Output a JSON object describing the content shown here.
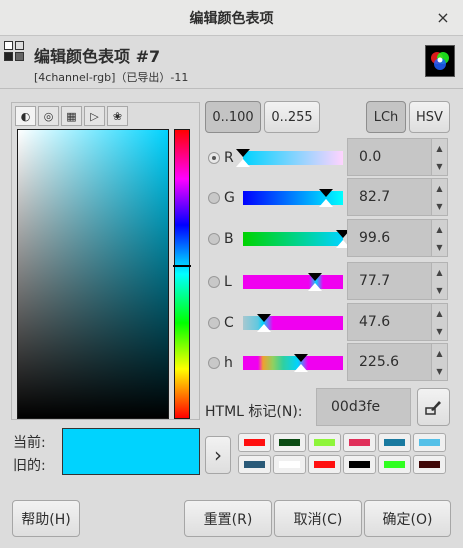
{
  "window": {
    "title": "编辑颜色表项",
    "close_label": "×"
  },
  "header": {
    "title": "编辑颜色表项 #7",
    "subtitle": "[4channel-rgb]（已导出）-11",
    "icon": "colormap-icon",
    "wheel_icon": "color-wheel-icon"
  },
  "selector_tabs": [
    {
      "icon": "gimp-icon",
      "glyph": "◐"
    },
    {
      "icon": "cmyk-icon",
      "glyph": "◎"
    },
    {
      "icon": "watercolor-icon",
      "glyph": "▦"
    },
    {
      "icon": "wheel-icon",
      "glyph": "▷"
    },
    {
      "icon": "palette-icon",
      "glyph": "❀"
    }
  ],
  "scale_buttons": {
    "range100": "0..100",
    "range255": "0..255"
  },
  "model_buttons": {
    "lch": "LCh",
    "hsv": "HSV"
  },
  "channels": [
    {
      "label": "R",
      "value": "0.0",
      "selected": true
    },
    {
      "label": "G",
      "value": "82.7",
      "selected": false
    },
    {
      "label": "B",
      "value": "99.6",
      "selected": false
    },
    {
      "label": "L",
      "value": "77.7",
      "selected": false
    },
    {
      "label": "C",
      "value": "47.6",
      "selected": false
    },
    {
      "label": "h",
      "value": "225.6",
      "selected": false
    }
  ],
  "html_notation": {
    "label": "HTML 标记(N):",
    "value": "00d3fe"
  },
  "current": {
    "current_label": "当前:",
    "old_label": "旧的:",
    "color": "#00d3fe"
  },
  "history_arrow": "›",
  "history_colors": [
    "#ff1010",
    "#0a4a12",
    "#8ef53a",
    "#e0305a",
    "#1a7aa0",
    "#54c0e8",
    "#2a5a78",
    "#ffffff",
    "#ff1010",
    "#000000",
    "#30ff20",
    "#400808"
  ],
  "buttons": {
    "help": "帮助(H)",
    "reset": "重置(R)",
    "cancel": "取消(C)",
    "ok": "确定(O)"
  },
  "colors": {
    "accent": "#00d3fe"
  }
}
